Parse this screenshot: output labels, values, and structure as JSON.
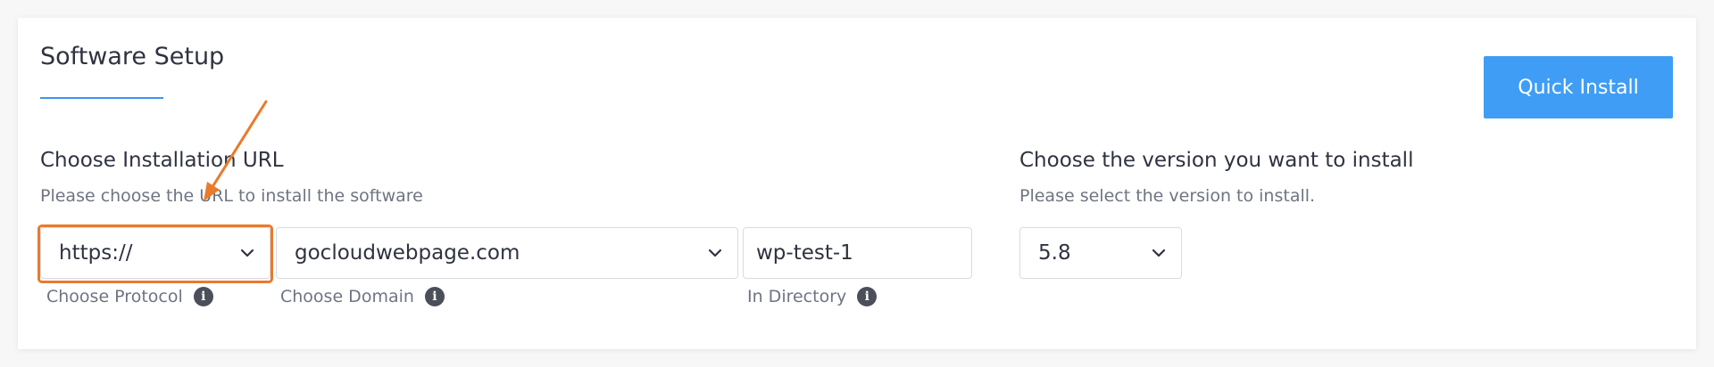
{
  "section": {
    "title": "Software Setup",
    "quick_install_label": "Quick Install"
  },
  "install_url": {
    "heading": "Choose Installation URL",
    "subtext": "Please choose the URL to install the software",
    "protocol": {
      "value": "https://",
      "label": "Choose Protocol"
    },
    "domain": {
      "value": "gocloudwebpage.com",
      "label": "Choose Domain"
    },
    "directory": {
      "value": "wp-test-1",
      "label": "In Directory"
    }
  },
  "version": {
    "heading": "Choose the version you want to install",
    "subtext": "Please select the version to install.",
    "value": "5.8"
  },
  "icons": {
    "info": "i"
  },
  "colors": {
    "accent": "#3f9df5",
    "underline": "#3d95f0",
    "highlight": "#ea7a2c",
    "info_icon": "#4b4f59"
  }
}
